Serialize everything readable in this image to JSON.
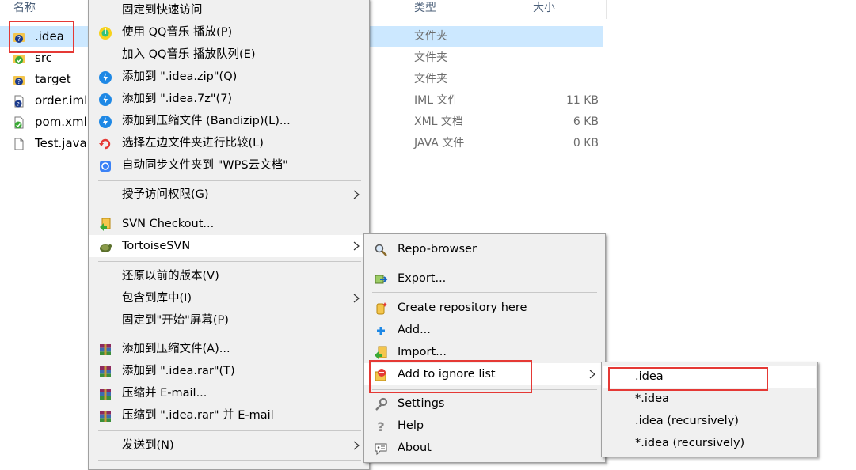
{
  "explorer": {
    "headers": {
      "name": "名称",
      "type": "类型",
      "size": "大小"
    },
    "files": [
      {
        "name": ".idea",
        "type": "文件夹",
        "size": ""
      },
      {
        "name": "src",
        "type": "文件夹",
        "size": ""
      },
      {
        "name": "target",
        "type": "文件夹",
        "size": ""
      },
      {
        "name": "order.iml",
        "type": "IML 文件",
        "size": "11 KB"
      },
      {
        "name": "pom.xml",
        "type": "XML 文档",
        "size": "6 KB"
      },
      {
        "name": "Test.java",
        "type": "JAVA 文件",
        "size": "0 KB"
      }
    ]
  },
  "context_menu": {
    "items": [
      {
        "label": "固定到快速访问"
      },
      {
        "label": "使用 QQ音乐 播放(P)",
        "icon": "qq-music-icon"
      },
      {
        "label": "加入 QQ音乐 播放队列(E)"
      },
      {
        "label": "添加到 \".idea.zip\"(Q)",
        "icon": "bandizip-icon"
      },
      {
        "label": "添加到 \".idea.7z\"(7)",
        "icon": "bandizip-icon"
      },
      {
        "label": "添加到压缩文件 (Bandizip)(L)...",
        "icon": "bandizip-icon"
      },
      {
        "label": "选择左边文件夹进行比较(L)",
        "icon": "compare-icon"
      },
      {
        "label": "自动同步文件夹到 \"WPS云文档\"",
        "icon": "wps-sync-icon"
      },
      {
        "label": "授予访问权限(G)",
        "submenu": true
      },
      {
        "label": "SVN Checkout...",
        "icon": "svn-checkout-icon"
      },
      {
        "label": "TortoiseSVN",
        "icon": "tortoisesvn-icon",
        "submenu": true
      },
      {
        "label": "还原以前的版本(V)"
      },
      {
        "label": "包含到库中(I)",
        "submenu": true
      },
      {
        "label": "固定到\"开始\"屏幕(P)"
      },
      {
        "label": "添加到压缩文件(A)...",
        "icon": "winrar-icon"
      },
      {
        "label": "添加到 \".idea.rar\"(T)",
        "icon": "winrar-icon"
      },
      {
        "label": "压缩并 E-mail...",
        "icon": "winrar-icon"
      },
      {
        "label": "压缩到 \".idea.rar\" 并 E-mail",
        "icon": "winrar-icon"
      },
      {
        "label": "发送到(N)",
        "submenu": true
      }
    ]
  },
  "svn_menu": {
    "items": [
      {
        "label": "Repo-browser",
        "icon": "repo-browser-icon"
      },
      {
        "label": "Export...",
        "icon": "export-icon"
      },
      {
        "label": "Create repository here",
        "icon": "create-repo-icon"
      },
      {
        "label": "Add...",
        "icon": "add-icon"
      },
      {
        "label": "Import...",
        "icon": "import-icon"
      },
      {
        "label": "Add to ignore list",
        "icon": "ignore-icon",
        "submenu": true
      },
      {
        "label": "Settings",
        "icon": "settings-icon"
      },
      {
        "label": "Help",
        "icon": "help-icon"
      },
      {
        "label": "About",
        "icon": "about-icon"
      }
    ]
  },
  "ignore_menu": {
    "items": [
      {
        "label": ".idea"
      },
      {
        "label": "*.idea"
      },
      {
        "label": ".idea (recursively)"
      },
      {
        "label": "*.idea (recursively)"
      }
    ]
  },
  "colors": {
    "highlight": "#ffffff",
    "selection": "#cce8ff",
    "annotation_red": "#e53935"
  }
}
